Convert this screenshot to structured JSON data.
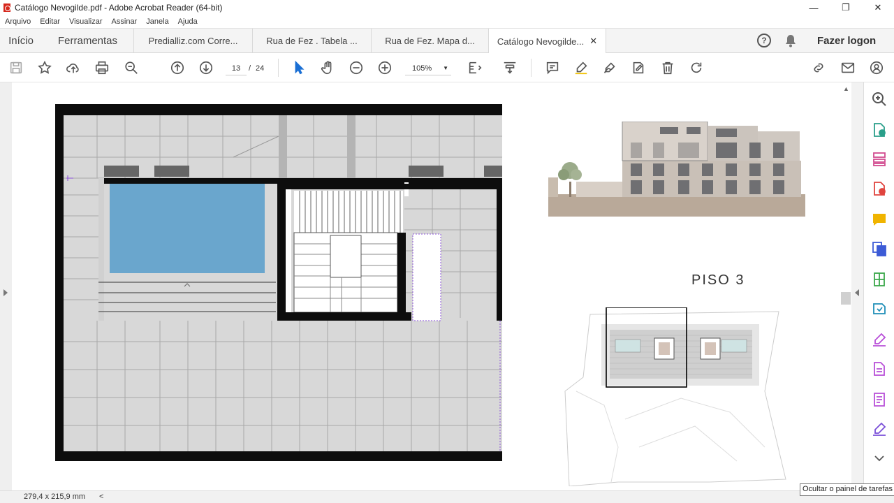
{
  "window": {
    "title": "Catálogo Nevogilde.pdf - Adobe Acrobat Reader (64-bit)",
    "controls": [
      "—",
      "❐",
      "✕"
    ]
  },
  "menu": [
    "Arquivo",
    "Editar",
    "Visualizar",
    "Assinar",
    "Janela",
    "Ajuda"
  ],
  "tabs": {
    "home": "Início",
    "tools": "Ferramentas",
    "documents": [
      {
        "label": "Predialliz.com Corre...",
        "active": false
      },
      {
        "label": "Rua de Fez . Tabela ...",
        "active": false
      },
      {
        "label": "Rua de Fez. Mapa d...",
        "active": false
      },
      {
        "label": "Catálogo Nevogilde...",
        "active": true
      }
    ],
    "close": "✕",
    "help": "?",
    "login": "Fazer logon"
  },
  "toolbar": {
    "page_current": "13",
    "page_separator": "/",
    "page_total": "24",
    "zoom": "105%"
  },
  "document": {
    "floor_label": "PISO 3"
  },
  "status": {
    "dimensions": "279,4 x 215,9 mm",
    "tooltip": "Ocultar o painel de tarefas"
  },
  "colors": {
    "pool": "#6aa6cd",
    "floor_tile": "#d8d8d8",
    "walls": "#0d0d0d",
    "ground": "#b9a999",
    "accent_purple": "#8a4fd8"
  }
}
